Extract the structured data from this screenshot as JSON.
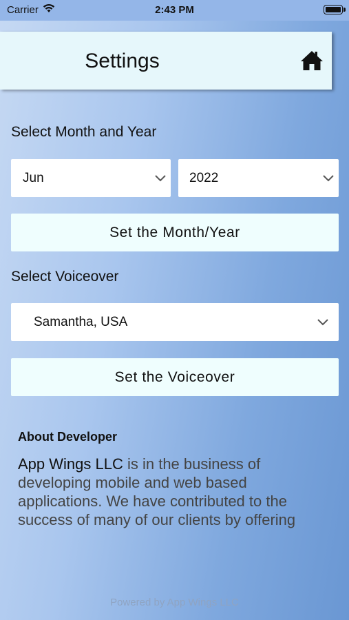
{
  "status_bar": {
    "carrier": "Carrier",
    "time": "2:43 PM"
  },
  "nav": {
    "title": "Settings",
    "home_icon": "home-icon"
  },
  "month_year": {
    "label": "Select Month and Year",
    "month": "Jun",
    "year": "2022",
    "button": "Set the Month/Year"
  },
  "voiceover": {
    "label": "Select Voiceover",
    "selected": "Samantha, USA",
    "button": "Set the Voiceover"
  },
  "about": {
    "heading": "About Developer",
    "company": "App Wings LLC",
    "text": " is in the business of developing mobile and web based applications. We have contributed to the success of many of our clients by offering"
  },
  "footer": "Powered by App Wings LLC"
}
